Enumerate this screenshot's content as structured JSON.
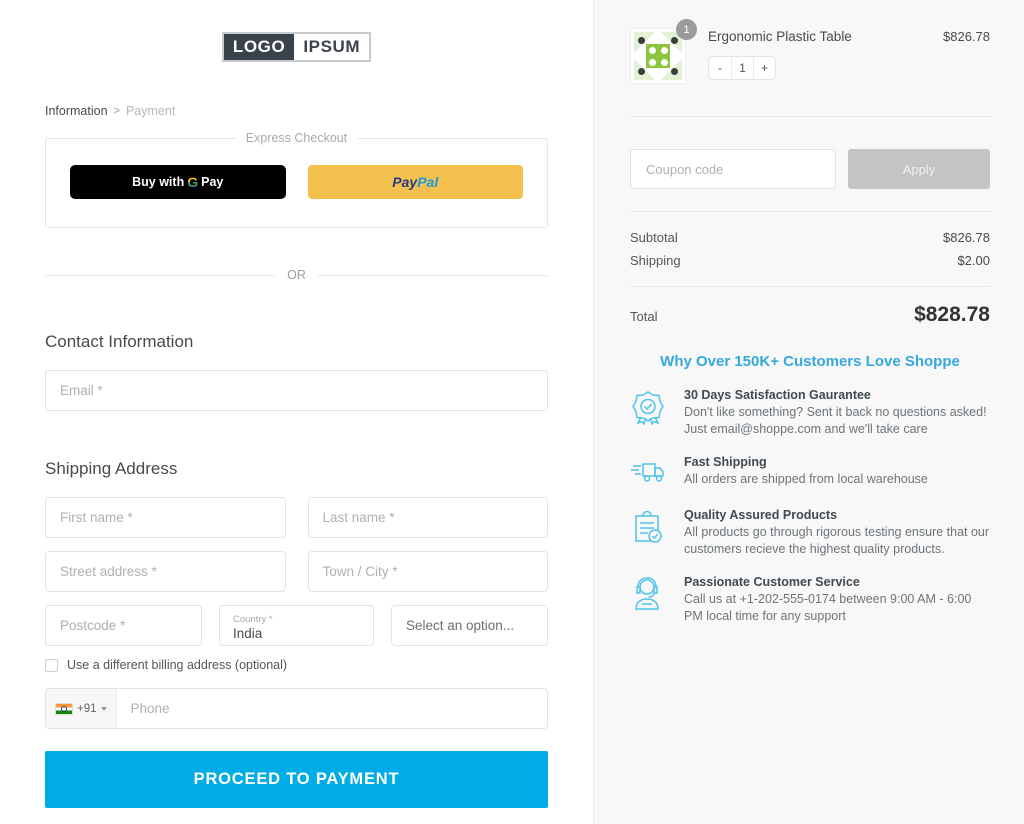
{
  "brand": {
    "logo_left": "LOGO",
    "logo_right": "IPSUM",
    "accent_blue": "#00ace5",
    "heading_blue": "#35a8e0"
  },
  "breadcrumb": {
    "step_current": "Information",
    "separator": ">",
    "step_next": "Payment"
  },
  "express": {
    "legend": "Express Checkout",
    "gpay_prefix": "Buy with",
    "gpay_g": "G",
    "gpay_pay": "Pay",
    "paypal_pay": "Pay",
    "paypal_pal": "Pal"
  },
  "divider": {
    "or": "OR"
  },
  "contact": {
    "heading": "Contact Information",
    "email_placeholder": "Email *"
  },
  "shipping": {
    "heading": "Shipping Address",
    "first_name_placeholder": "First name *",
    "last_name_placeholder": "Last name *",
    "street_placeholder": "Street address *",
    "town_placeholder": "Town / City *",
    "postcode_placeholder": "Postcode *",
    "country_label": "Country *",
    "country_value": "India",
    "state_placeholder": "Select an option...",
    "billing_checkbox_label": "Use a different billing address (optional)",
    "phone_country_code": "+91",
    "phone_placeholder": "Phone"
  },
  "submit": {
    "label": "PROCEED TO PAYMENT"
  },
  "cart": {
    "items": [
      {
        "name": "Ergonomic Plastic Table",
        "price": "$826.78",
        "quantity_badge": "1",
        "qty_decrement": "-",
        "qty_value": "1",
        "qty_increment": "+"
      }
    ],
    "coupon_placeholder": "Coupon code",
    "apply_label": "Apply",
    "summary": [
      {
        "label": "Subtotal",
        "value": "$826.78"
      },
      {
        "label": "Shipping",
        "value": "$2.00"
      }
    ],
    "total_label": "Total",
    "total_value": "$828.78"
  },
  "why": {
    "title": "Why Over 150K+ Customers Love Shoppe",
    "features": [
      {
        "icon": "satisfaction-badge-icon",
        "title": "30 Days Satisfaction Gaurantee",
        "desc": "Don't like something? Sent it back no questions asked! Just email@shoppe.com and we'll take care"
      },
      {
        "icon": "delivery-truck-icon",
        "title": "Fast Shipping",
        "desc": "All orders are shipped from local warehouse"
      },
      {
        "icon": "clipboard-check-icon",
        "title": "Quality Assured Products",
        "desc": "All products go through rigorous testing ensure that our customers recieve the highest quality products."
      },
      {
        "icon": "headset-agent-icon",
        "title": "Passionate Customer Service",
        "desc": "Call us at +1-202-555-0174 between 9:00 AM - 6:00 PM local time for any support"
      }
    ]
  }
}
